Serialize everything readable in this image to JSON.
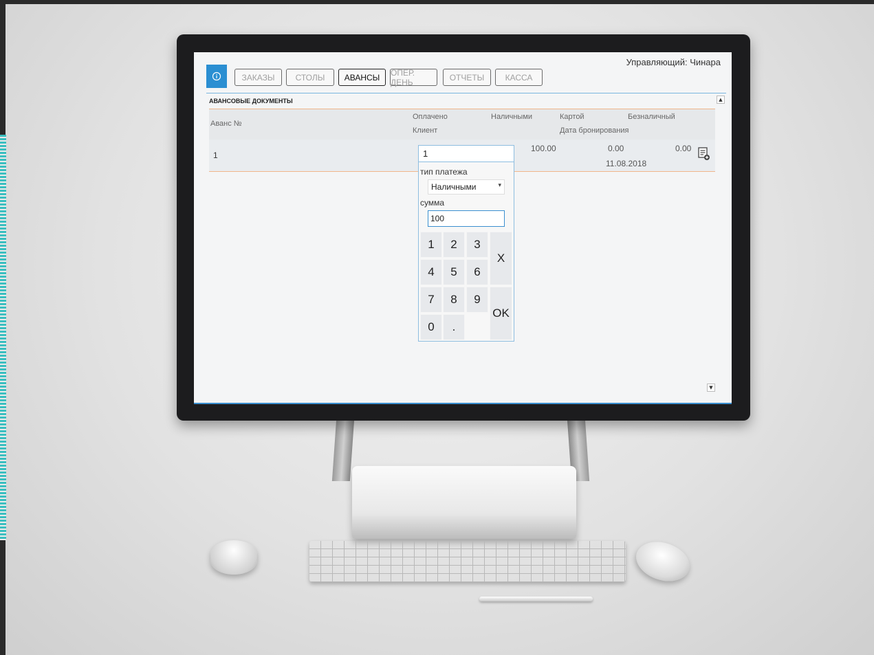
{
  "app": {
    "manager_label": "Управляющий:",
    "manager_name": "Чинара",
    "info_icon": "info-icon",
    "nav": [
      "ЗАКАЗЫ",
      "СТОЛЫ",
      "АВАНСЫ",
      "ОПЕР. ДЕНЬ",
      "ОТЧЕТЫ",
      "КАССА"
    ],
    "active_tab": "АВАНСЫ",
    "section_title": "АВАНСОВЫЕ ДОКУМЕНТЫ"
  },
  "table": {
    "headers": {
      "advance_no": "Аванс №",
      "paid": "Оплачено",
      "client": "Клиент",
      "cash": "Наличными",
      "card": "Картой",
      "noncash": "Безналичный",
      "booking_date": "Дата бронирования"
    },
    "rows": [
      {
        "advance_no": "1",
        "cash": "100.00",
        "card": "0.00",
        "noncash": "0.00",
        "booking_date": "11.08.2018",
        "action_icon": "document-add-icon"
      }
    ]
  },
  "popup": {
    "paid_value": "1",
    "payment_type_label": "тип платежа",
    "payment_type_value": "Наличными",
    "sum_label": "сумма",
    "sum_value": "100",
    "keys": [
      "1",
      "2",
      "3",
      "4",
      "5",
      "6",
      "7",
      "8",
      "9",
      "0",
      "."
    ],
    "clear_key": "X",
    "ok_key": "OK"
  }
}
